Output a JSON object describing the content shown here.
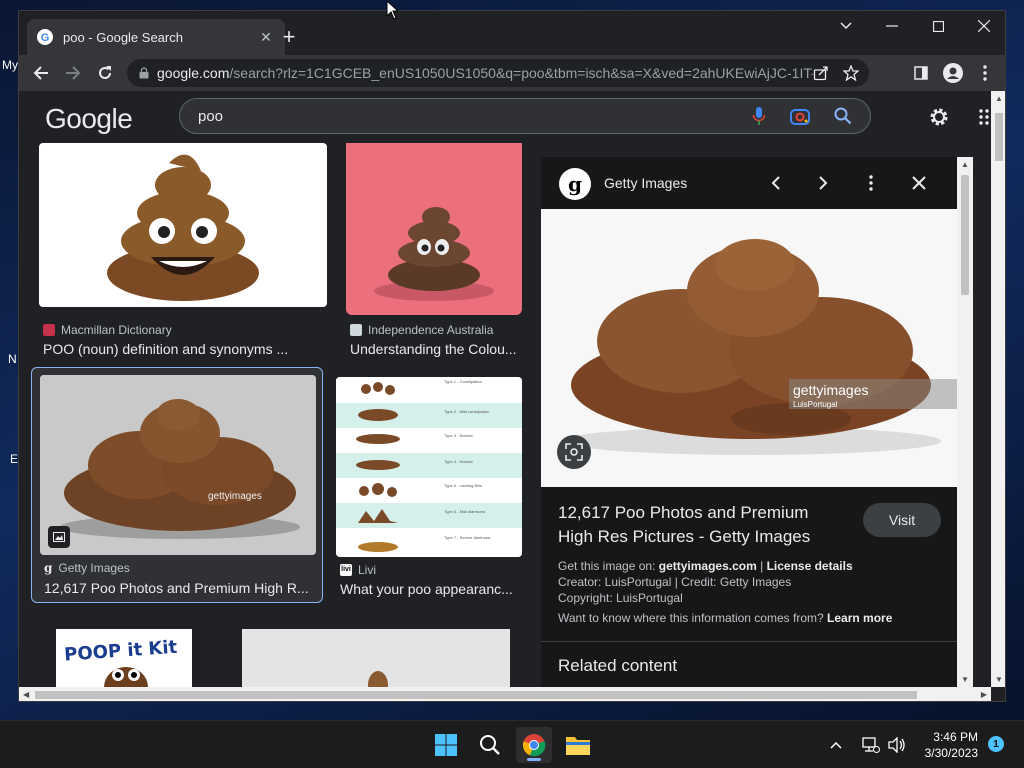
{
  "desktop": {
    "fragments": [
      "My",
      "N",
      "E"
    ]
  },
  "browser": {
    "tab_title": "poo - Google Search",
    "url_host": "google.com",
    "url_rest": "/search?rlz=1C1GCEB_enUS1050US1050&q=poo&tbm=isch&sa=X&ved=2ahUKEwiAjJC-1IT-A..."
  },
  "google": {
    "logo": "Google",
    "query": "poo"
  },
  "results": [
    {
      "source": "Macmillan Dictionary",
      "title": "POO (noun) definition and synonyms ..."
    },
    {
      "source": "Independence Australia",
      "title": "Understanding the Colou..."
    },
    {
      "source": "Getty Images",
      "title": "12,617 Poo Photos and Premium High R..."
    },
    {
      "source": "Livi",
      "title": "What your poo appearanc..."
    }
  ],
  "bottom_thumb": {
    "text": "POOP it Kit"
  },
  "chart_labels": [
    "Type 1 - Constipation",
    "Type 2 - Mild constipation",
    "Type 3 - Normal",
    "Type 4 - Normal",
    "Type 5 - Lacking fibre",
    "Type 6 - Mild diarrhoea",
    "Type 7 - Severe diarrhoea"
  ],
  "panel": {
    "source": "Getty Images",
    "watermark": "gettyimages",
    "watermark_credit": "LuisPortugal",
    "title": "12,617 Poo Photos and Premium High Res Pictures - Getty Images",
    "visit": "Visit",
    "get_image_prefix": "Get this image on:",
    "get_image_site": "gettyimages.com",
    "license": "License details",
    "creator_credit": "Creator: LuisPortugal | Credit: Getty Images",
    "copyright": "Copyright: LuisPortugal",
    "info_prefix": "Want to know where this information comes from?",
    "learn_more": "Learn more",
    "related": "Related content"
  },
  "taskbar": {
    "time": "3:46 PM",
    "date": "3/30/2023",
    "notifications": "1"
  },
  "colors": {
    "accent": "#8ab4f8",
    "page_bg": "#202124",
    "panel_bg": "#171717",
    "poo_brown": "#8b5a2b"
  }
}
